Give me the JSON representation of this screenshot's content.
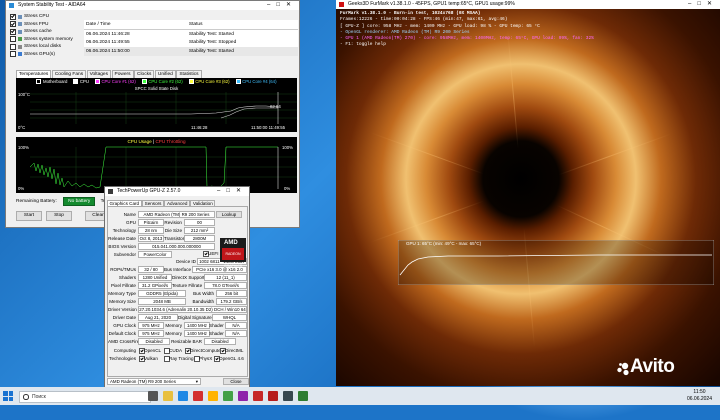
{
  "stability": {
    "title": "System Stability Test - AIDA64",
    "checks": [
      {
        "label": "Stress CPU",
        "checked": true
      },
      {
        "label": "Stress FPU",
        "checked": true
      },
      {
        "label": "Stress cache",
        "checked": true
      },
      {
        "label": "Stress system memory",
        "checked": false
      },
      {
        "label": "Stress local disks",
        "checked": false
      },
      {
        "label": "Stress GPU(s)",
        "checked": false
      }
    ],
    "table_headers": {
      "date": "Date / Time",
      "status": "Status"
    },
    "rows": [
      {
        "date": "06.06.2024 11:46:28",
        "status": "Stability Test: Started"
      },
      {
        "date": "06.06.2024 11:49:55",
        "status": "Stability Test: Stopped"
      },
      {
        "date": "06.06.2024 11:50:00",
        "status": "Stability Test: Started"
      }
    ],
    "tabs": [
      "Temperatures",
      "Cooling Fans",
      "Voltages",
      "Powers",
      "Clocks",
      "Unified",
      "Statistics"
    ],
    "legend": [
      "Motherboard",
      "CPU",
      "CPU Core #1 (62)",
      "CPU Core #2 (62)",
      "CPU Core #3 (62)",
      "CPU Core #4 (64)"
    ],
    "legend2": "SPCC Solid State Disk",
    "temp_y_top": "100°C",
    "temp_y_bottom": "0°C",
    "temp_right_values": "62 64",
    "temp_x_labels": [
      "11:46:28",
      "11:50:00 11:49:55"
    ],
    "cpu_title": "CPU Usage",
    "cpu_throttle": "CPU Throttling",
    "cpu_y_top": "100%",
    "cpu_y_bottom": "0%",
    "cpu_right": "100%",
    "cpu_right_bottom": "0%",
    "battery_label": "Remaining Battery:",
    "battery_value": "No battery",
    "test_started_label": "Test Started:",
    "buttons": {
      "start": "Start",
      "stop": "Stop",
      "clear": "Clear"
    }
  },
  "furmark": {
    "title": "Geeks3D FurMark v1.38.1.0 - 45FPS, GPU1 temp:65°C, GPU1 usage:99%",
    "lines": [
      {
        "text": "FurMark v1.38.1.0 - Burn-in test, 1024x768 (0X MSAA)",
        "color": "#ffffff"
      },
      {
        "text": "Frames:12226 - time:00:04:28 - FPS:46 (min:47, max:61, avg:46)",
        "color": "#ffffff"
      },
      {
        "text": "[ GPU-Z ] core: 958 MHz - mem: 1400 MHz - GPU load: 98 % - GPU temp: 65 °C",
        "color": "#ffffff"
      },
      {
        "text": "- OpenGL renderer: AMD Radeon (TM) R9 200 Series",
        "color": "#9fd8ff"
      },
      {
        "text": "- GPU 1 (AMD Radeon(TM) 270) - core: 958MHz, mem: 1400MHz, temp: 65°C, GPU load: 99%, fan: 32%",
        "color": "#ff66ff"
      },
      {
        "text": "- F1: toggle help",
        "color": "#ffffff"
      }
    ],
    "graph_label": "GPU 1: 65°C (min: 49°C - max: 65°C)"
  },
  "gpuz": {
    "title": "TechPowerUp GPU-Z 2.57.0",
    "tabs": [
      "Graphics Card",
      "Sensors",
      "Advanced",
      "Validation"
    ],
    "lookup": "Lookup",
    "fields": {
      "name": {
        "label": "Name",
        "value": "AMD Radeon (TM) R9 200 Series"
      },
      "gpu": {
        "label": "GPU",
        "value": "Pitcairn"
      },
      "revision": {
        "label": "Revision",
        "value": "00"
      },
      "tech": {
        "label": "Technology",
        "value": "28 nm"
      },
      "die": {
        "label": "Die Size",
        "value": "212 mm²"
      },
      "release": {
        "label": "Release Date",
        "value": "Oct 8, 2013"
      },
      "transistors": {
        "label": "Transistors",
        "value": "2800M"
      },
      "bios": {
        "label": "BIOS Version",
        "value": "015.041.000.000.000000"
      },
      "uefi": {
        "label": "UEFI"
      },
      "subvendor": {
        "label": "Subvendor",
        "value": "PowerColor"
      },
      "device_id": {
        "label": "Device ID",
        "value": "1002 6811 - 148C 2337"
      },
      "rops": {
        "label": "ROPs/TMUs",
        "value": "32 / 80"
      },
      "bus": {
        "label": "Bus Interface",
        "value": "PCIe x16 3.0 @ x16 2.0"
      },
      "shaders": {
        "label": "Shaders",
        "value": "1280 Unified"
      },
      "dx": {
        "label": "DirectX Support",
        "value": "12 (11_1)"
      },
      "pixel": {
        "label": "Pixel Fillrate",
        "value": "31.2 GPixel/s"
      },
      "texture": {
        "label": "Texture Fillrate",
        "value": "78.0 GTexel/s"
      },
      "memtype": {
        "label": "Memory Type",
        "value": "GDDR5 (Elpida)"
      },
      "buswidth": {
        "label": "Bus Width",
        "value": "256 bit"
      },
      "memsize": {
        "label": "Memory Size",
        "value": "2048 MB"
      },
      "bandwidth": {
        "label": "Bandwidth",
        "value": "179.2 GB/s"
      },
      "driver": {
        "label": "Driver Version",
        "value": "27.20.1034.6 (Adrenalin 20.10.35 D2) DCH / Win10 64"
      },
      "driver_date": {
        "label": "Driver Date",
        "value": "Aug 21, 2020"
      },
      "sig": {
        "label": "Digital Signature",
        "value": "WHQL"
      },
      "gpu_clock": {
        "label": "GPU Clock",
        "value": "975 MHz"
      },
      "mem_clock": {
        "label": "Memory",
        "value": "1400 MHz"
      },
      "shader_clock": {
        "label": "Shader",
        "value": "N/A"
      },
      "def_clock": {
        "label": "Default Clock",
        "value": "975 MHz"
      },
      "def_mem": {
        "label": "Memory",
        "value": "1400 MHz"
      },
      "def_shader": {
        "label": "Shader",
        "value": "N/A"
      },
      "crossfire": {
        "label": "AMD CrossFire",
        "value": "Disabled"
      },
      "rebar": {
        "label": "Resizable BAR",
        "value": "Disabled"
      }
    },
    "computing_label": "Computing",
    "computing": [
      "OpenCL",
      "CUDA",
      "DirectCompute",
      "DirectML"
    ],
    "tech_label": "Technologies",
    "technologies": [
      "Vulkan",
      "Ray Tracing",
      "PhysX",
      "OpenGL 4.6"
    ],
    "select": "AMD Radeon (TM) R9 200 Series",
    "close": "Close",
    "logo_text": "AMD",
    "logo_sub": "RADEON GRAPHICS"
  },
  "taskbar": {
    "search_placeholder": "Поиск",
    "time": "11:50",
    "date": "06.06.2024"
  },
  "watermark": "Avito"
}
